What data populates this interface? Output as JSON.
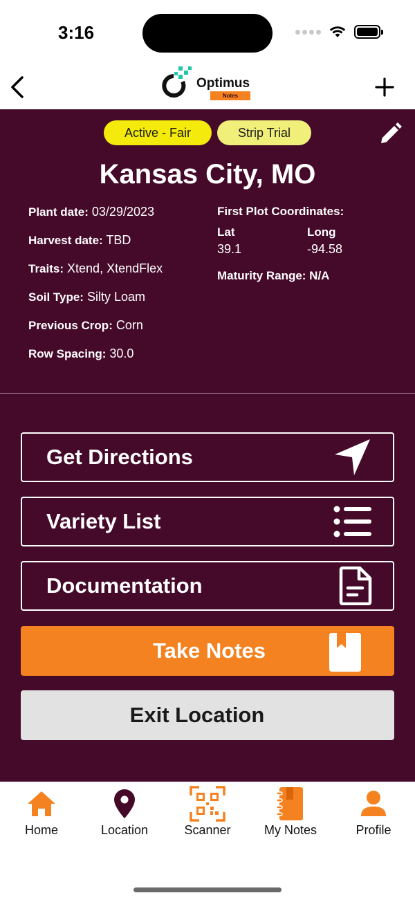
{
  "status_bar": {
    "time": "3:16"
  },
  "header": {
    "logo_name": "Optimus",
    "logo_badge": "Notes"
  },
  "location": {
    "badges": [
      "Active - Fair",
      "Strip Trial"
    ],
    "title": "Kansas City, MO",
    "details": [
      {
        "label": "Plant date:",
        "value": " 03/29/2023"
      },
      {
        "label": "Harvest date:",
        "value": " TBD"
      },
      {
        "label": "Traits:",
        "value": " Xtend, XtendFlex"
      },
      {
        "label": "Soil Type:",
        "value": " Silty Loam"
      },
      {
        "label": "Previous Crop:",
        "value": " Corn"
      },
      {
        "label": "Row Spacing:",
        "value": " 30.0"
      }
    ],
    "coords": {
      "heading": "First Plot Coordinates:",
      "lat_label": "Lat",
      "lat_value": "39.1",
      "long_label": "Long",
      "long_value": "-94.58"
    },
    "maturity": "Maturity Range: N/A"
  },
  "actions": {
    "directions": "Get Directions",
    "variety": "Variety List",
    "documentation": "Documentation",
    "notes": "Take Notes",
    "exit": "Exit Location"
  },
  "tabs": [
    {
      "label": "Home",
      "icon": "home-icon"
    },
    {
      "label": "Location",
      "icon": "location-pin-icon"
    },
    {
      "label": "Scanner",
      "icon": "qr-scanner-icon"
    },
    {
      "label": "My Notes",
      "icon": "notebook-icon"
    },
    {
      "label": "Profile",
      "icon": "profile-icon"
    }
  ],
  "colors": {
    "panel": "#450a2a",
    "accent_orange": "#f58220",
    "badge_active": "#f4ea0c",
    "badge_trial": "#f0ef7a",
    "exit_button": "#e2e2e2"
  }
}
